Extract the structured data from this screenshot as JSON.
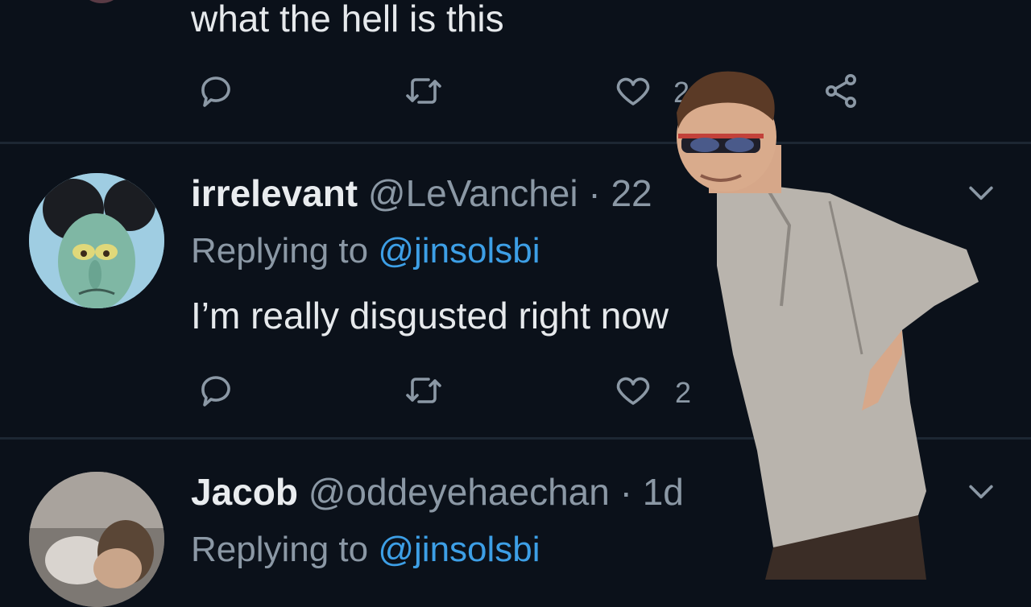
{
  "tweet_top": {
    "body": "what the hell is this",
    "like_count": "2",
    "icons": [
      "reply-icon",
      "retweet-icon",
      "like-icon",
      "share-icon"
    ]
  },
  "tweet_1": {
    "name": "irrelevant",
    "handle": "@LeVanchei",
    "time": " · 22",
    "replying_prefix": "Replying to ",
    "replying_to": "@jinsolsbi",
    "body": "I’m really disgusted right now",
    "like_count": "2"
  },
  "tweet_2": {
    "name": "Jacob",
    "handle": "@oddeyehaechan",
    "time": " · 1d",
    "replying_prefix": "Replying to ",
    "replying_to": "@jinsolsbi"
  },
  "colors": {
    "background": "#0b111a",
    "mention": "#3d9fe6",
    "muted": "#8b98a5",
    "divider": "#1d2733"
  }
}
